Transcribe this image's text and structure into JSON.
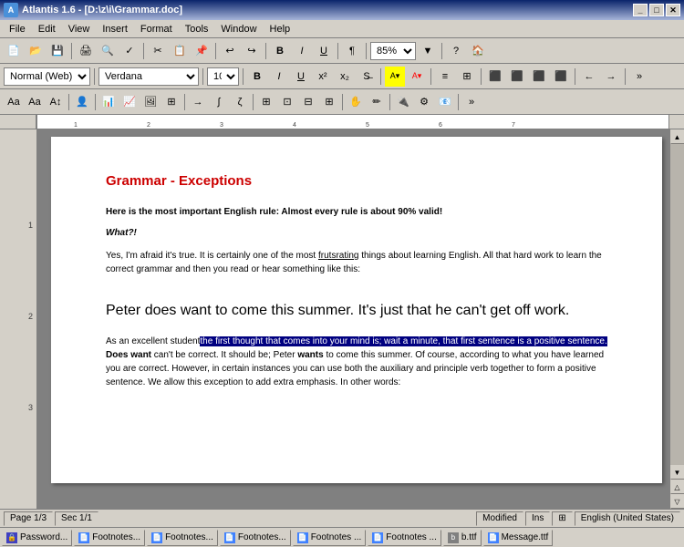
{
  "titleBar": {
    "title": "Atlantis 1.6 - [D:\\z\\i\\Grammar.doc]",
    "icon": "A",
    "controls": [
      "_",
      "□",
      "✕"
    ]
  },
  "menuBar": {
    "items": [
      "File",
      "Edit",
      "View",
      "Insert",
      "Format",
      "Tools",
      "Window",
      "Help"
    ]
  },
  "toolbar1": {
    "zoom": "85%",
    "buttons": [
      "new",
      "open",
      "save",
      "print",
      "preview",
      "spell",
      "find",
      "bold",
      "italic",
      "underline"
    ]
  },
  "fmtToolbar": {
    "style": "Normal (Web)",
    "font": "Verdana",
    "size": "10",
    "bold": "B",
    "italic": "I",
    "underline": "U"
  },
  "document": {
    "title": "Grammar - Exceptions",
    "para1": "Here is the most important English rule: Almost every rule is about 90% valid!",
    "para2_label": "What?!",
    "para3": "Yes, I'm afraid it's true. It is certainly one of the most frutsrating things about learning English. All that hard work to learn the correct grammar and then you read or hear something like this:",
    "large_text": "Peter does want to come this summer. It's just that he can't get off work.",
    "para4_start": "As an excellent student",
    "para4_selected": "the first thought that comes into your mind is; wait a minute, that first sentence is a positive sentence.",
    "para4_cont": " Does want can't be correct. It should be; Peter ",
    "para4_wants": "wants",
    "para4_end": " to come this summer. Of course, according to what you have learned you are correct. However, in certain instances you can use both the auxiliary and principle verb together to form a positive sentence. We allow this exception to add extra emphasis. In other words:"
  },
  "statusBar": {
    "page": "Page 1/3",
    "sec": "Sec 1/1",
    "modified": "Modified",
    "ins": "Ins",
    "icon1": "🔒",
    "lang": "English (United States)"
  },
  "taskbar": {
    "items": [
      {
        "icon": "doc",
        "label": "Password..."
      },
      {
        "icon": "doc",
        "label": "Footnotes..."
      },
      {
        "icon": "doc",
        "label": "Footnotes..."
      },
      {
        "icon": "doc",
        "label": "Footnotes..."
      },
      {
        "icon": "doc",
        "label": "Footnotes ..."
      },
      {
        "icon": "doc",
        "label": "Footnotes ..."
      },
      {
        "icon": "gray",
        "label": "b.ttf"
      },
      {
        "icon": "doc",
        "label": "Message.ttf"
      }
    ]
  }
}
